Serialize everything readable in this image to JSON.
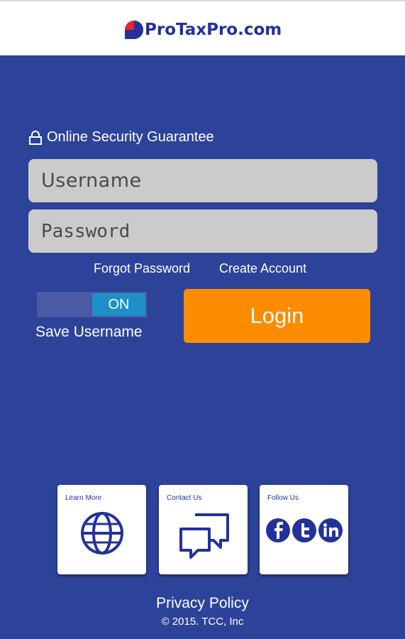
{
  "header": {
    "logo_text": "ProTaxPro.com"
  },
  "login": {
    "security_label": "Online Security Guarantee",
    "username_placeholder": "Username",
    "password_placeholder": "Password",
    "forgot_password": "Forgot Password",
    "create_account": "Create Account",
    "toggle_state": "ON",
    "save_username": "Save Username",
    "login_label": "Login"
  },
  "tiles": [
    {
      "label": "Learn More",
      "icon": "globe-icon"
    },
    {
      "label": "Contact Us",
      "icon": "chat-icon"
    },
    {
      "label": "Follow Us",
      "icon": "social-icons"
    }
  ],
  "footer": {
    "privacy": "Privacy Policy",
    "copyright": "© 2015. TCC, Inc"
  },
  "colors": {
    "background": "#2d439a",
    "accent": "#fb8c00",
    "toggle_on": "#1e8fc8",
    "field_bg": "#cbcbcb",
    "brand": "#23329a",
    "logo_red": "#e3262c"
  }
}
